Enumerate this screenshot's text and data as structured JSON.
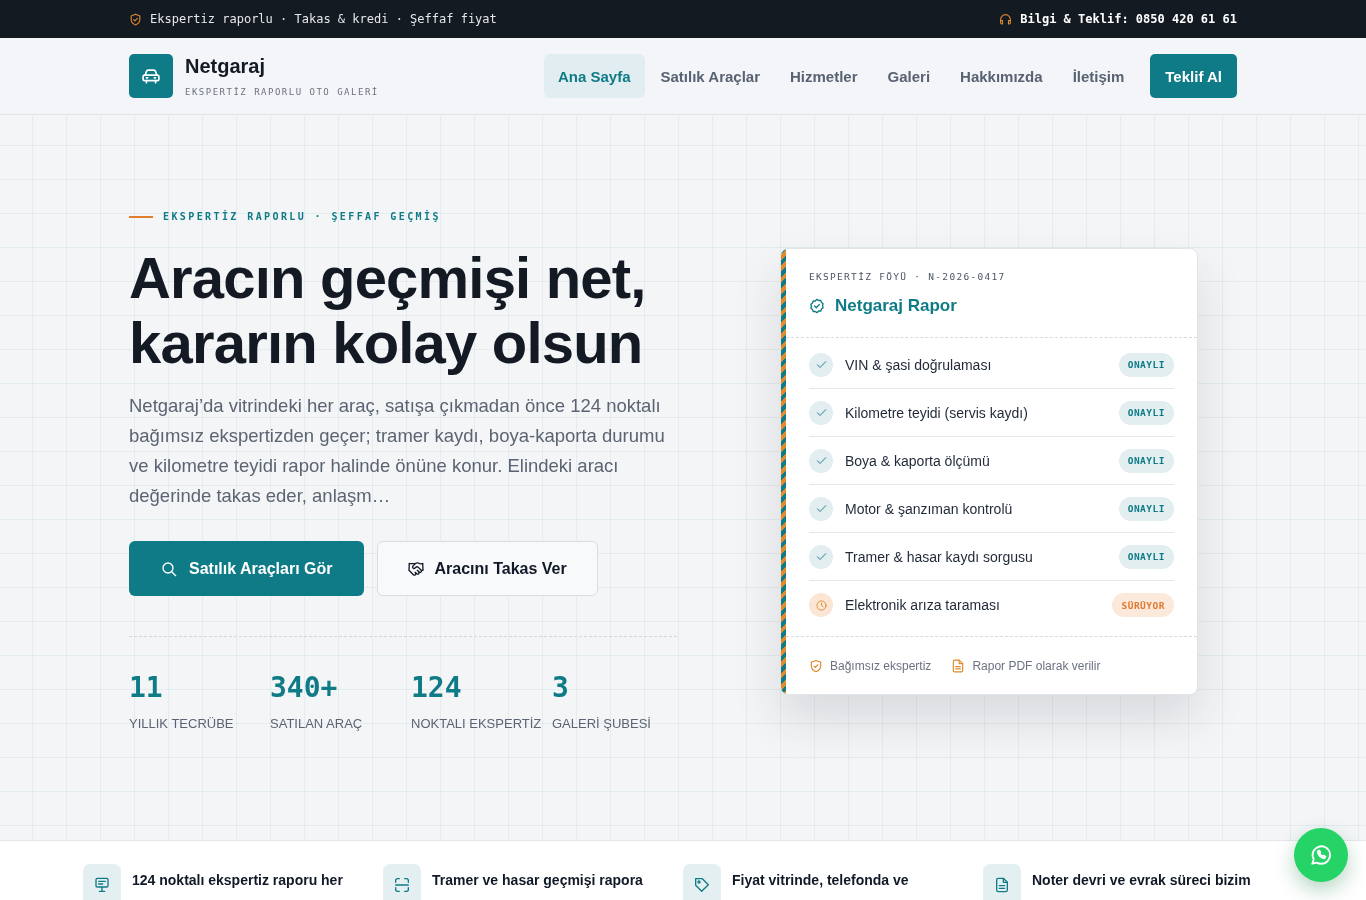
{
  "top_bar": {
    "left_text": "Ekspertiz raporlu · Takas & kredi · Şeffaf fiyat",
    "contact": "Bilgi & Teklif: 0850 420 61 61"
  },
  "header": {
    "brand": {
      "name": "Netgaraj",
      "tagline": "EKSPERTİZ RAPORLU OTO GALERİ"
    },
    "nav": [
      {
        "label": "Ana Sayfa",
        "selected": true
      },
      {
        "label": "Satılık Araçlar",
        "selected": false
      },
      {
        "label": "Hizmetler",
        "selected": false
      },
      {
        "label": "Galeri",
        "selected": false
      },
      {
        "label": "Hakkımızda",
        "selected": false
      },
      {
        "label": "İletişim",
        "selected": false
      }
    ],
    "cta": "Teklif Al"
  },
  "hero": {
    "eyebrow": "EKSPERTİZ RAPORLU · ŞEFFAF GEÇMİŞ",
    "title": "Aracın geçmişi net, kararın kolay olsun",
    "description": "Netgaraj’da vitrindeki her araç, satışa çıkmadan önce 124 noktalı bağımsız ekspertizden geçer; tramer kaydı, boya-kaporta durumu ve kilometre teyidi rapor halinde önüne konur. Elindeki aracı değerinde takas eder, anlaşm…",
    "buttons": [
      {
        "label": "Satılık Araçları Gör",
        "kind": "primary"
      },
      {
        "label": "Aracını Takas Ver",
        "kind": "secondary"
      }
    ],
    "stats": [
      {
        "value": "11",
        "label": "YILLIK TECRÜBE"
      },
      {
        "value": "340+",
        "label": "SATILAN ARAÇ"
      },
      {
        "value": "124",
        "label": "NOKTALI EKSPERTİZ"
      },
      {
        "value": "3",
        "label": "GALERİ ŞUBESİ"
      }
    ]
  },
  "report_card": {
    "eyebrow": "EKSPERTİZ FÖYÜ · N-2026-0417",
    "title": "Netgaraj Rapor",
    "checks": [
      {
        "label": "VIN & şasi doğrulaması",
        "status": "ONAYLI",
        "kind": "done"
      },
      {
        "label": "Kilometre teyidi (servis kaydı)",
        "status": "ONAYLI",
        "kind": "done"
      },
      {
        "label": "Boya & kaporta ölçümü",
        "status": "ONAYLI",
        "kind": "done"
      },
      {
        "label": "Motor & şanzıman kontrolü",
        "status": "ONAYLI",
        "kind": "done"
      },
      {
        "label": "Tramer & hasar kaydı sorgusu",
        "status": "ONAYLI",
        "kind": "done"
      },
      {
        "label": "Elektronik arıza taraması",
        "status": "SÜRÜYOR",
        "kind": "pending"
      }
    ],
    "footer": [
      "Bağımsız ekspertiz",
      "Rapor PDF olarak verilir"
    ]
  },
  "features": [
    {
      "title": "124 noktalı ekspertiz raporu her"
    },
    {
      "title": "Tramer ve hasar geçmişi rapora"
    },
    {
      "title": "Fiyat vitrinde, telefonda ve"
    },
    {
      "title": "Noter devri ve evrak süreci bizim"
    }
  ]
}
